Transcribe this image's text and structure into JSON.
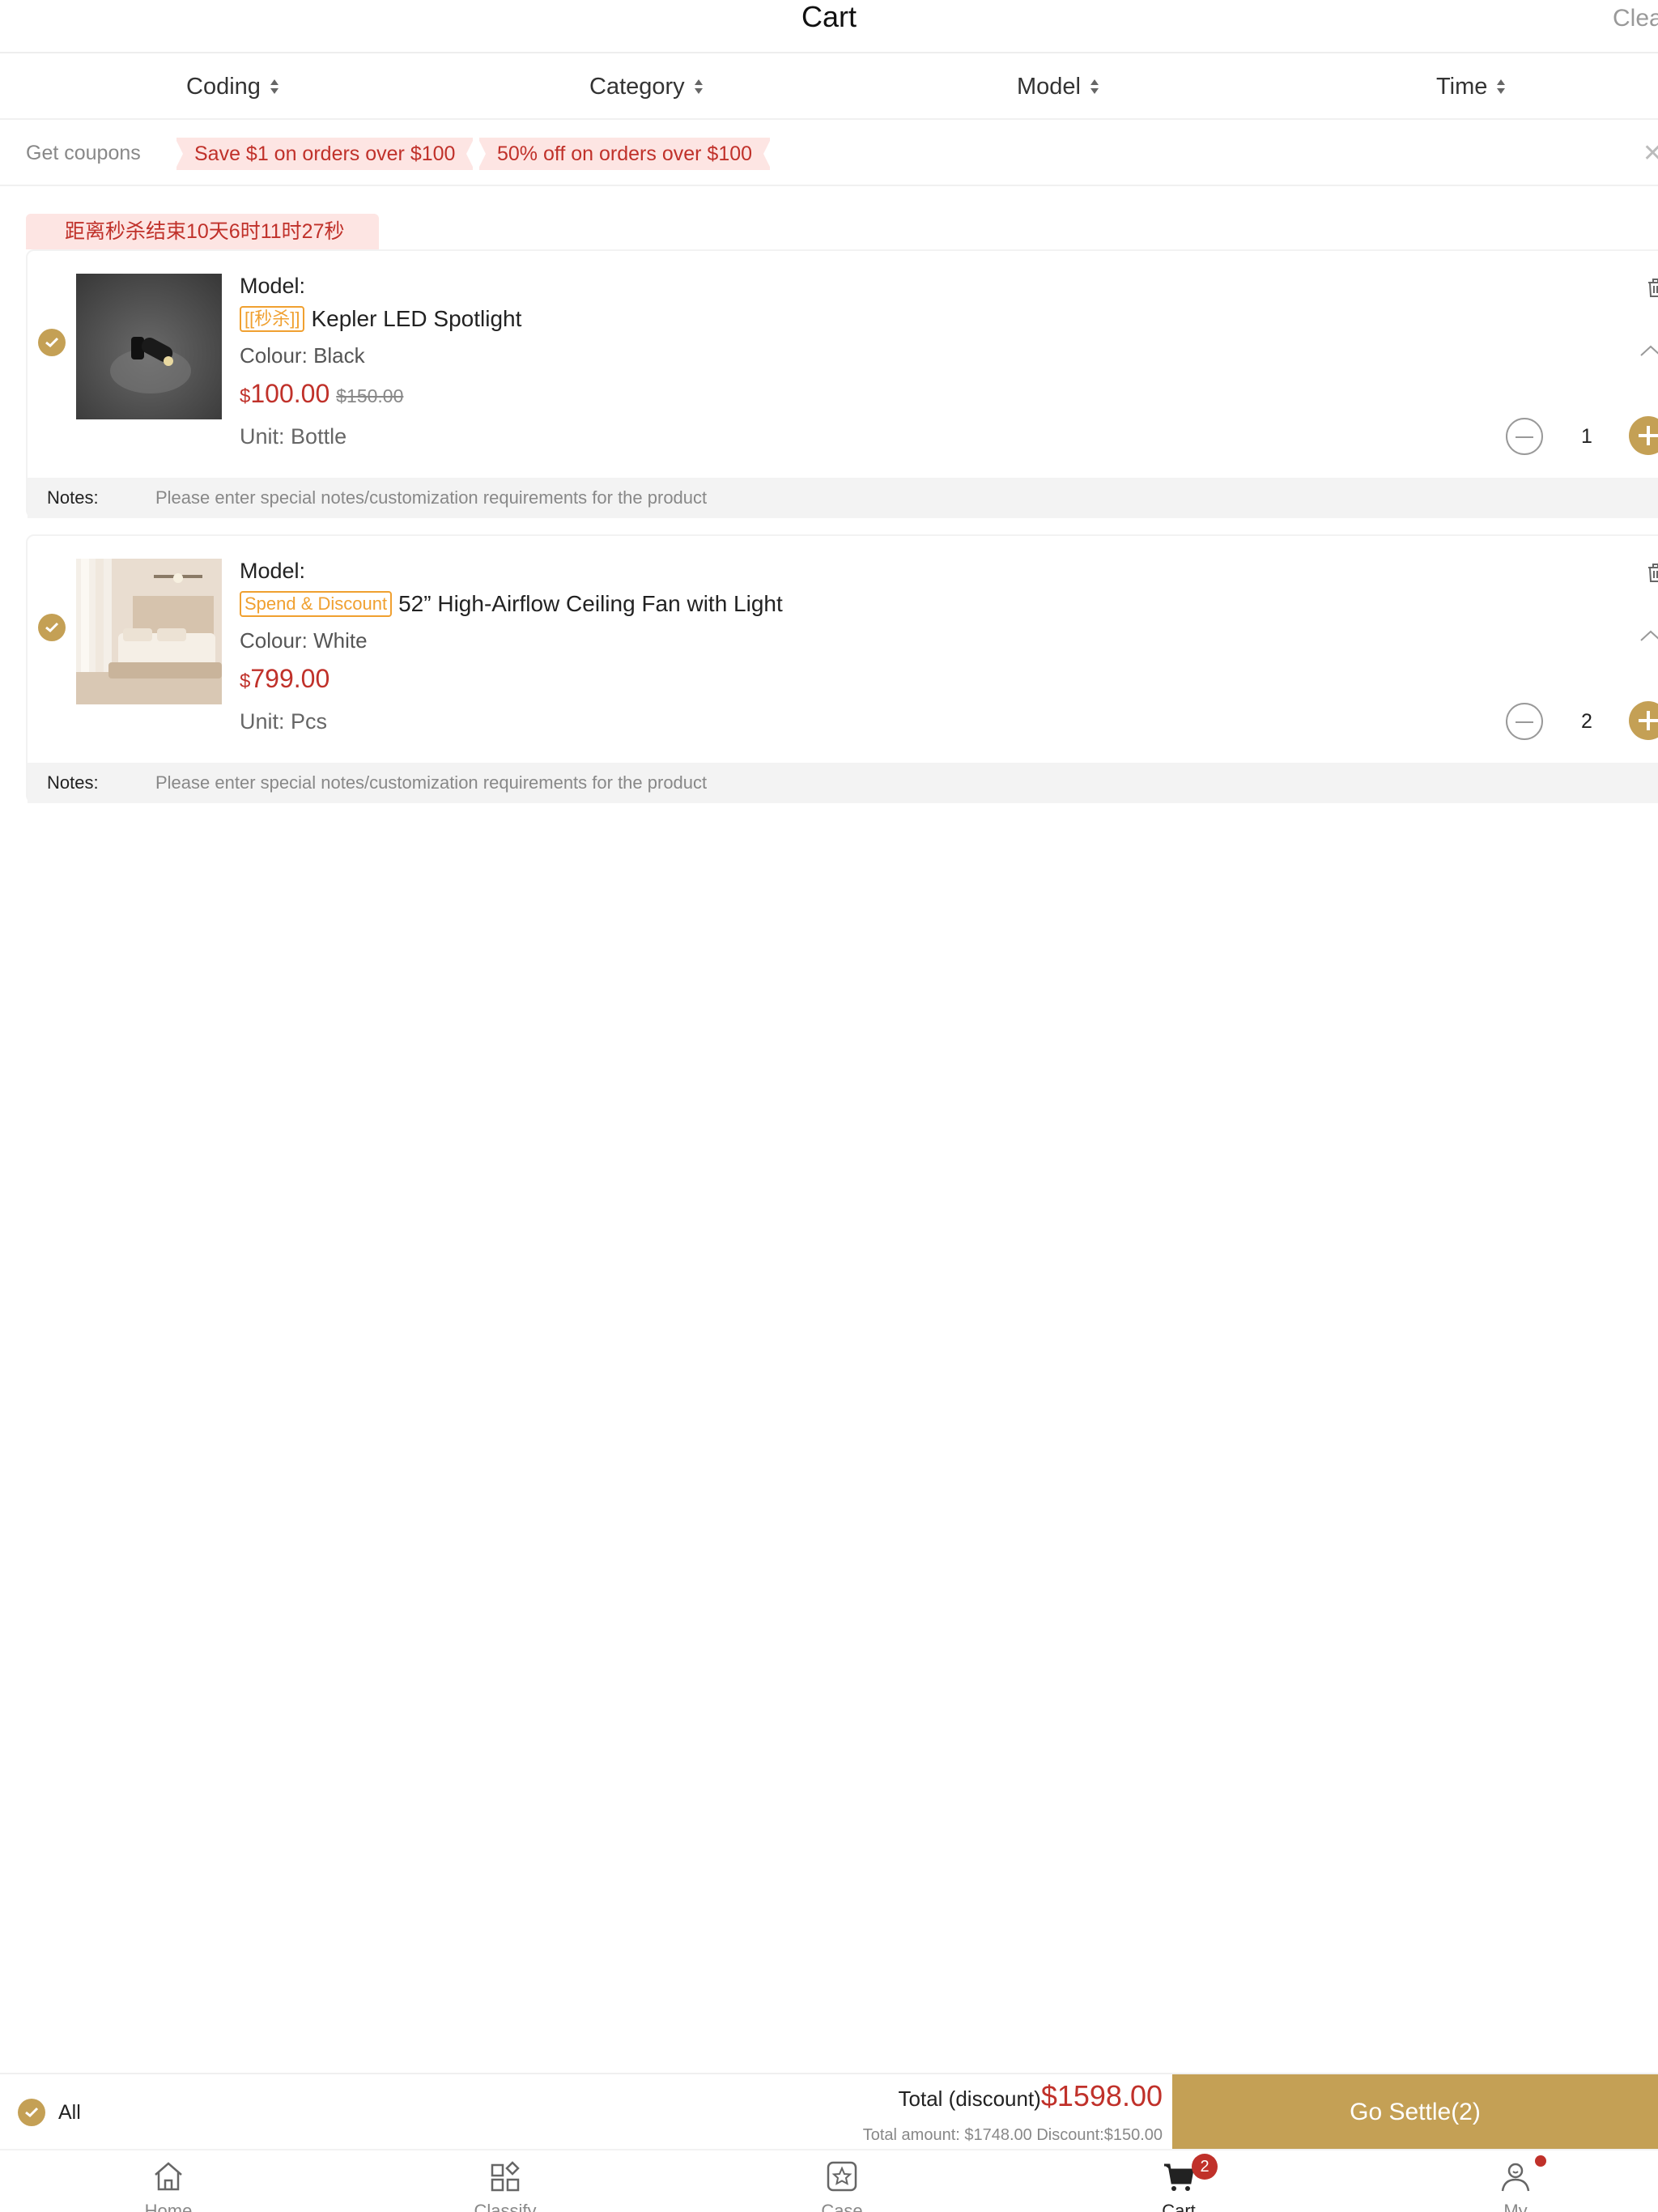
{
  "header": {
    "title": "Cart",
    "clear_label": "Clear"
  },
  "sort_bar": [
    {
      "label": "Coding"
    },
    {
      "label": "Category"
    },
    {
      "label": "Model"
    },
    {
      "label": "Time"
    }
  ],
  "coupons": {
    "label": "Get coupons",
    "items": [
      "Save $1 on orders over $100",
      "50% off on orders over $100"
    ]
  },
  "flash_banner": "距离秒杀结束10天6时11时27秒",
  "products": [
    {
      "model_label": "Model:",
      "tag": "[[秒杀]]",
      "name": "Kepler LED Spotlight",
      "colour_label": "Colour:",
      "colour": "Black",
      "currency": "$",
      "price": "100.00",
      "original_price": "$150.00",
      "unit_label": "Unit:",
      "unit": "Bottle",
      "quantity": "1",
      "notes_label": "Notes:",
      "notes_placeholder": "Please enter special notes/customization requirements for the product"
    },
    {
      "model_label": "Model:",
      "tag": "Spend & Discount",
      "name": "52” High-Airflow Ceiling Fan with Light",
      "colour_label": "Colour:",
      "colour": "White",
      "currency": "$",
      "price": "799.00",
      "original_price": "",
      "unit_label": "Unit:",
      "unit": "Pcs",
      "quantity": "2",
      "notes_label": "Notes:",
      "notes_placeholder": "Please enter special notes/customization requirements for the product"
    }
  ],
  "settle": {
    "all_label": "All",
    "total_label": "Total (discount)",
    "total_amount": "$1598.00",
    "summary": "Total amount: $1748.00 Discount:$150.00",
    "button_label": "Go Settle(2)"
  },
  "tabbar": {
    "items": [
      {
        "label": "Home",
        "icon": "home-icon"
      },
      {
        "label": "Classify",
        "icon": "grid-icon"
      },
      {
        "label": "Case",
        "icon": "star-icon"
      },
      {
        "label": "Cart",
        "icon": "cart-icon",
        "badge": "2"
      },
      {
        "label": "My",
        "icon": "user-icon"
      }
    ]
  },
  "colors": {
    "accent": "#c4a055",
    "price": "#c0312a",
    "tag": "#f0a030"
  }
}
